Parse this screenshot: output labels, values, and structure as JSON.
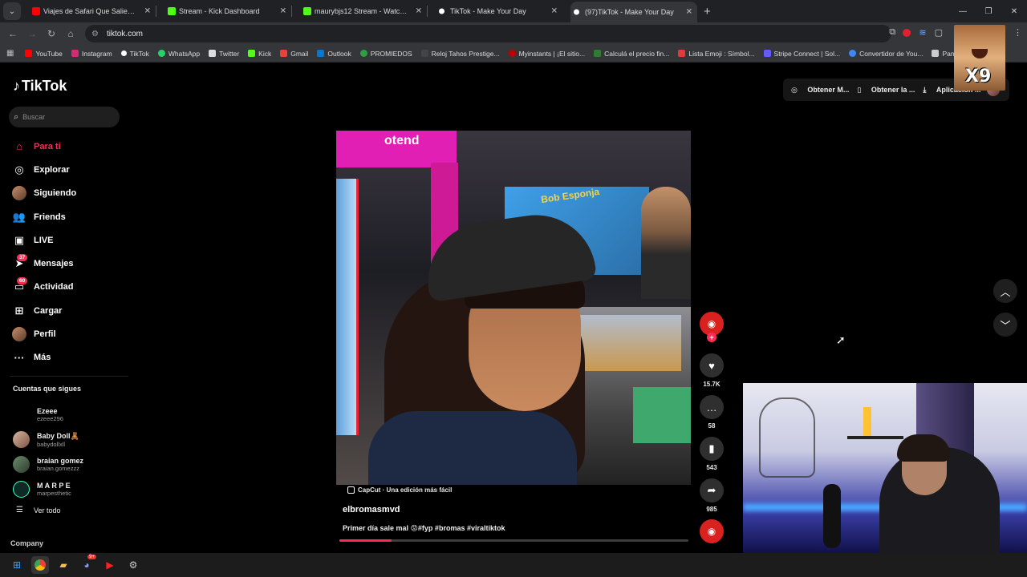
{
  "browser": {
    "tabs": [
      {
        "title": "Viajes de Safari Que Salieron Te",
        "favicon_color": "#ff0000",
        "active": false
      },
      {
        "title": "Stream - Kick Dashboard",
        "favicon_color": "#53fc18",
        "active": false
      },
      {
        "title": "maurybjs12 Stream - Watch Live",
        "favicon_color": "#53fc18",
        "active": false
      },
      {
        "title": "TikTok - Make Your Day",
        "favicon_color": "#ffffff",
        "active": false
      },
      {
        "title": "(97)TikTok - Make Your Day",
        "favicon_color": "#ffffff",
        "active": true
      }
    ],
    "url": "tiktok.com",
    "bookmarks": [
      {
        "label": "YouTube",
        "color": "#ff0000"
      },
      {
        "label": "Instagram",
        "color": "#d62976"
      },
      {
        "label": "TikTok",
        "color": "#ffffff"
      },
      {
        "label": "WhatsApp",
        "color": "#25d366"
      },
      {
        "label": "Twitter",
        "color": "#dddddd"
      },
      {
        "label": "Kick",
        "color": "#53fc18"
      },
      {
        "label": "Gmail",
        "color": "#ea4335"
      },
      {
        "label": "Outlook",
        "color": "#0078d4"
      },
      {
        "label": "PROMIEDOS",
        "color": "#2ea043"
      },
      {
        "label": "Reloj Tahos Prestige...",
        "color": "#222222"
      },
      {
        "label": "Myinstants | ¡El sitio...",
        "color": "#c00000"
      },
      {
        "label": "Calculá el precio fin...",
        "color": "#2e7d32"
      },
      {
        "label": "Lista Emoji : Símbol...",
        "color": "#e53935"
      },
      {
        "label": "Stripe Connect | Sol...",
        "color": "#635bff"
      },
      {
        "label": "Convertidor de You...",
        "color": "#4285f4"
      },
      {
        "label": "Panzoid",
        "color": "#cccccc"
      }
    ]
  },
  "tiktok": {
    "logo": "TikTok",
    "search_placeholder": "Buscar",
    "nav": [
      {
        "label": "Para ti",
        "icon": "home-icon",
        "active": true,
        "badge": ""
      },
      {
        "label": "Explorar",
        "icon": "compass-icon",
        "active": false,
        "badge": ""
      },
      {
        "label": "Siguiendo",
        "icon": "following-avatar-icon",
        "active": false,
        "badge": ""
      },
      {
        "label": "Friends",
        "icon": "friends-icon",
        "active": false,
        "badge": ""
      },
      {
        "label": "LIVE",
        "icon": "live-icon",
        "active": false,
        "badge": ""
      },
      {
        "label": "Mensajes",
        "icon": "messages-icon",
        "active": false,
        "badge": "37"
      },
      {
        "label": "Actividad",
        "icon": "activity-icon",
        "active": false,
        "badge": "60"
      },
      {
        "label": "Cargar",
        "icon": "upload-icon",
        "active": false,
        "badge": ""
      },
      {
        "label": "Perfil",
        "icon": "profile-icon",
        "active": false,
        "badge": ""
      },
      {
        "label": "Más",
        "icon": "more-icon",
        "active": false,
        "badge": ""
      }
    ],
    "following_header": "Cuentas que sigues",
    "following": [
      {
        "name": "Ezeee",
        "handle": "ezeee296"
      },
      {
        "name": "Baby Doll🧸",
        "handle": "babydollxll"
      },
      {
        "name": "braian gomez",
        "handle": "braian.gomezzz"
      },
      {
        "name": "M A R P E",
        "handle": "marpesthetic"
      }
    ],
    "see_all": "Ver todo",
    "company": "Company",
    "top_buttons": [
      "Obtener M...",
      "Obtener la ...",
      "Aplicación ..."
    ],
    "video": {
      "capcut": "CapCut · Una edición más fácil",
      "author": "elbromasmvd",
      "caption": "Primer día sale mal 😡#fyp #bromas #viraltiktok",
      "progress": 0.15,
      "sign_text": "otend",
      "poster_text": "Bob Esponja"
    },
    "actions": {
      "likes": "15.7K",
      "comments": "58",
      "saves": "543",
      "shares": "985"
    }
  },
  "overlay": {
    "meme_text": "X9"
  }
}
